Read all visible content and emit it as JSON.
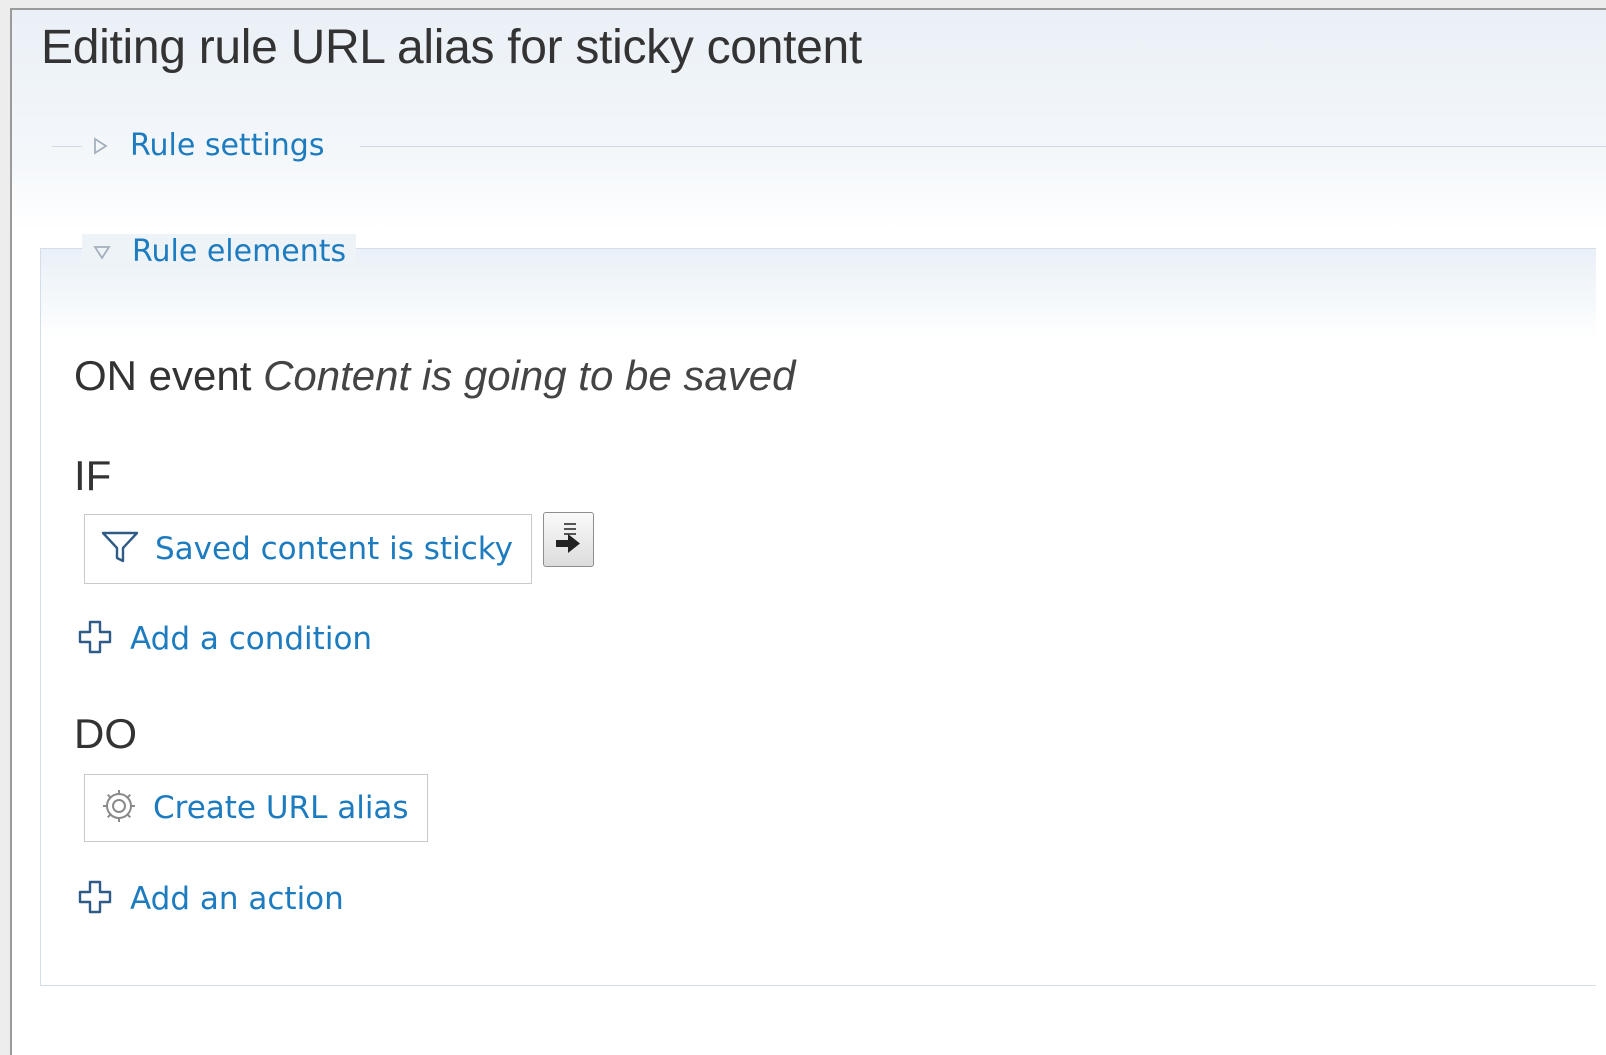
{
  "page": {
    "title": "Editing rule URL alias for sticky content"
  },
  "rule_settings": {
    "label": "Rule settings",
    "state": "collapsed"
  },
  "rule_elements": {
    "label": "Rule elements",
    "state": "expanded",
    "on_prefix": "ON event",
    "event_name": "Content is going to be saved",
    "if_heading": "IF",
    "conditions": [
      {
        "label": "Saved content is sticky",
        "icon": "filter-icon"
      }
    ],
    "add_condition_label": "Add a condition",
    "do_heading": "DO",
    "actions": [
      {
        "label": "Create URL alias",
        "icon": "gear-icon"
      }
    ],
    "add_action_label": "Add an action"
  },
  "colors": {
    "link": "#1d7bbf",
    "heading_text": "#333333",
    "fieldset_border": "#d4dee8"
  }
}
